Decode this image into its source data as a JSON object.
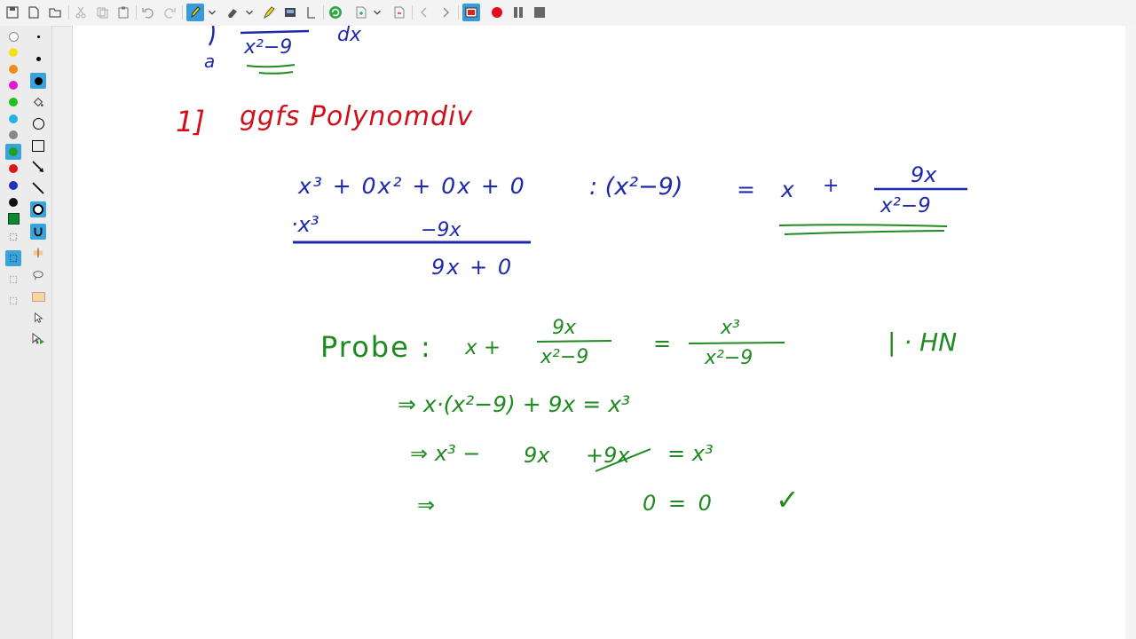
{
  "toolbar": {
    "icons": [
      "save-icon",
      "new-page-icon",
      "open-folder-icon",
      "cut-icon",
      "copy-icon",
      "paste-icon",
      "undo-icon",
      "redo-icon",
      "pen-icon",
      "eraser-icon",
      "highlighter-icon",
      "image-icon",
      "text-cursor-icon",
      "refresh-icon",
      "add-page-icon",
      "delete-page-icon",
      "previous-page-icon",
      "next-page-icon",
      "record-screen-icon",
      "record-icon",
      "pause-icon",
      "stop-icon"
    ]
  },
  "sidebar": {
    "colors": [
      "#ffffff",
      "#f2e21a",
      "#f08a1c",
      "#e01ad0",
      "#20c020",
      "#22b4e6",
      "#888888",
      "#1fa02a",
      "#d81818",
      "#2030c0",
      "#111111",
      "#0f8a2a"
    ]
  },
  "canvas": {
    "top_integral": {
      "denominator": "x²−9",
      "lower_bound": "a",
      "differential": "dx"
    },
    "heading": {
      "number": "1]",
      "text": "ggfs Polynomdiv"
    },
    "division": {
      "dividend": "x³ + 0x² + 0x + 0",
      "divisor": ": (x²−9)",
      "equals": "=",
      "quotient_x": "x",
      "plus": "+",
      "remainder_num": "9x",
      "remainder_den": "x²−9",
      "sub_row_left": "·x³",
      "sub_row_right": "−9x",
      "remainder_row": "9x + 0"
    },
    "check": {
      "label": "Probe :",
      "lhs_x": "x  +",
      "lhs_num": "9x",
      "lhs_den": "x²−9",
      "equals": "=",
      "rhs_num": "x³",
      "rhs_den": "x²−9",
      "note": "| · HN",
      "line2": "⇒  x·(x²−9) + 9x  =  x³",
      "line3_a": "⇒  x³ −",
      "line3_b": "9x",
      "line3_c": "+9x",
      "line3_d": "=  x³",
      "line4_arrow": "⇒",
      "line4_eq": "0 = 0",
      "checkmark": "✓"
    }
  }
}
